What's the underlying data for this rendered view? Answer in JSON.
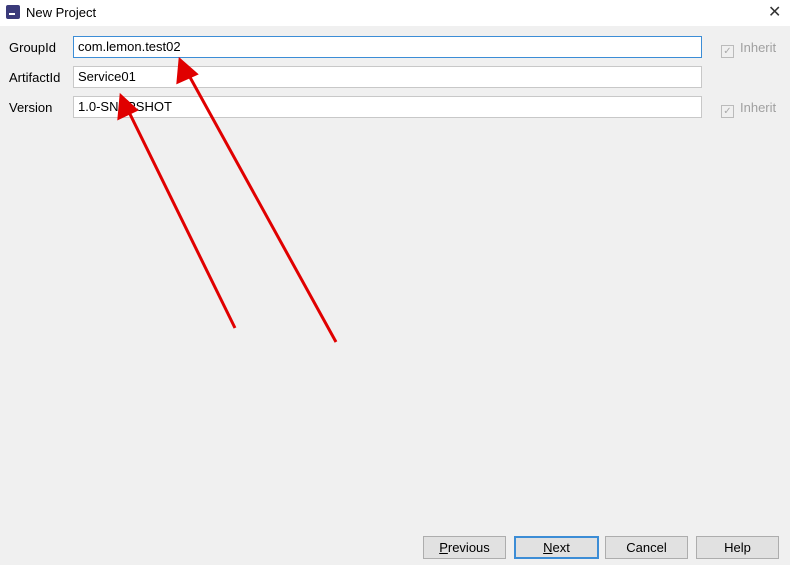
{
  "window": {
    "title": "New Project",
    "close_icon": "close-icon"
  },
  "form": {
    "group_id": {
      "label": "GroupId",
      "value": "com.lemon.test02",
      "inherit": "Inherit"
    },
    "artifact_id": {
      "label": "ArtifactId",
      "value": "Service01"
    },
    "version": {
      "label": "Version",
      "value": "1.0-SNAPSHOT",
      "inherit": "Inherit"
    }
  },
  "buttons": {
    "previous_first": "P",
    "previous_rest": "revious",
    "next_first": "N",
    "next_rest": "ext",
    "cancel": "Cancel",
    "help": "Help"
  },
  "annotation_color": "#e00000"
}
